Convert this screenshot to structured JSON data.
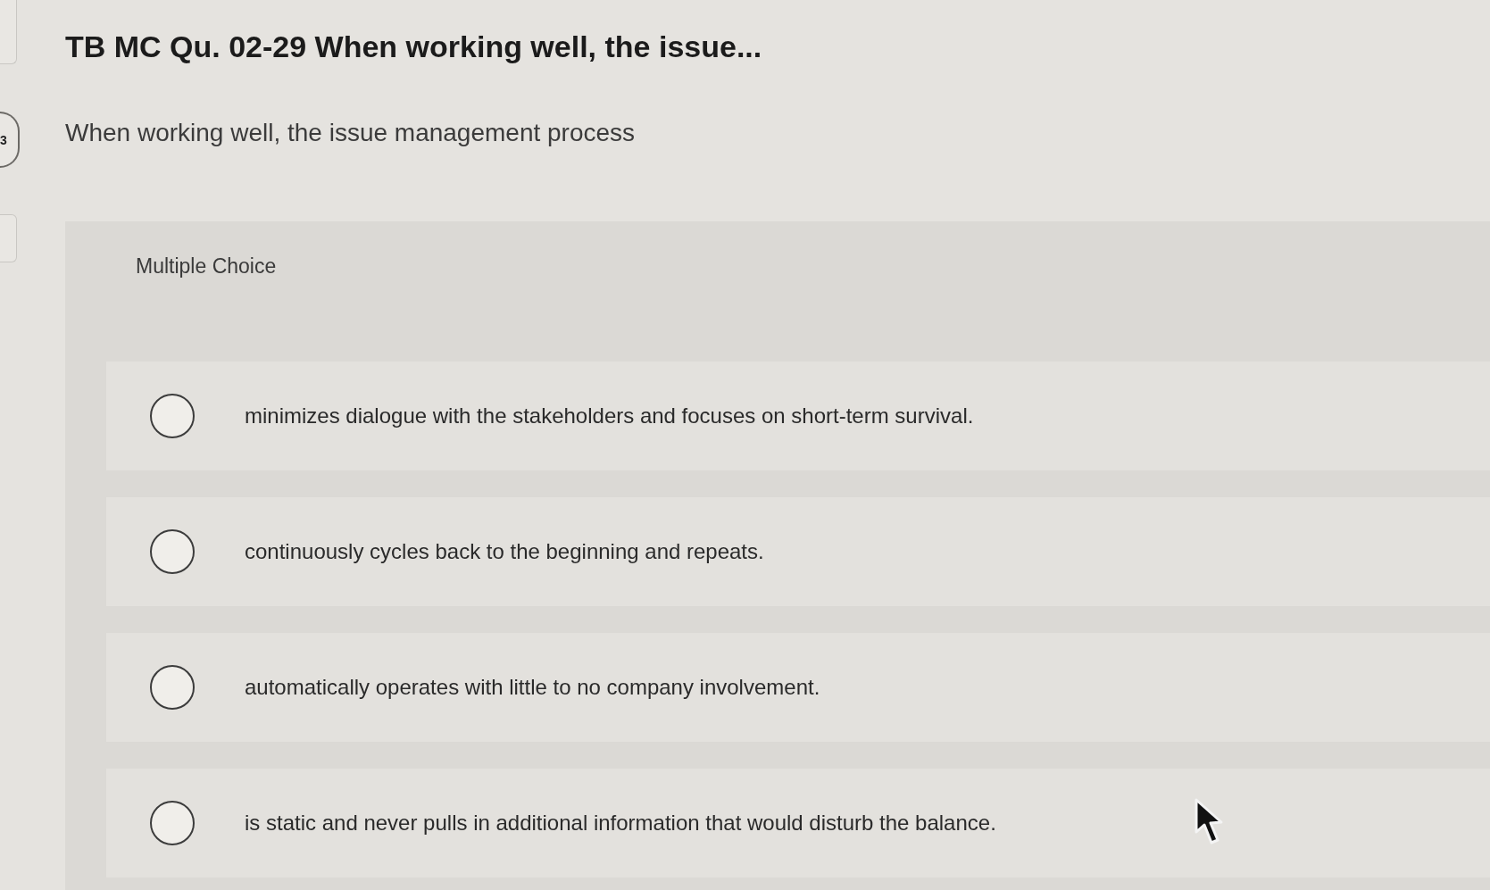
{
  "sidebar": {
    "items": [
      {
        "kind": "card"
      },
      {
        "kind": "number",
        "label": "3"
      },
      {
        "kind": "card"
      }
    ]
  },
  "question": {
    "title": "TB MC Qu. 02-29 When working well, the issue...",
    "prompt": "When working well, the issue management process"
  },
  "answer_panel": {
    "type_label": "Multiple Choice",
    "options": [
      {
        "text": "minimizes dialogue with the stakeholders and focuses on short-term survival.",
        "selected": false
      },
      {
        "text": "continuously cycles back to the beginning and repeats.",
        "selected": false
      },
      {
        "text": "automatically operates with little to no company involvement.",
        "selected": false
      },
      {
        "text": "is static and never pulls in additional information that would disturb the balance.",
        "selected": false
      }
    ]
  }
}
